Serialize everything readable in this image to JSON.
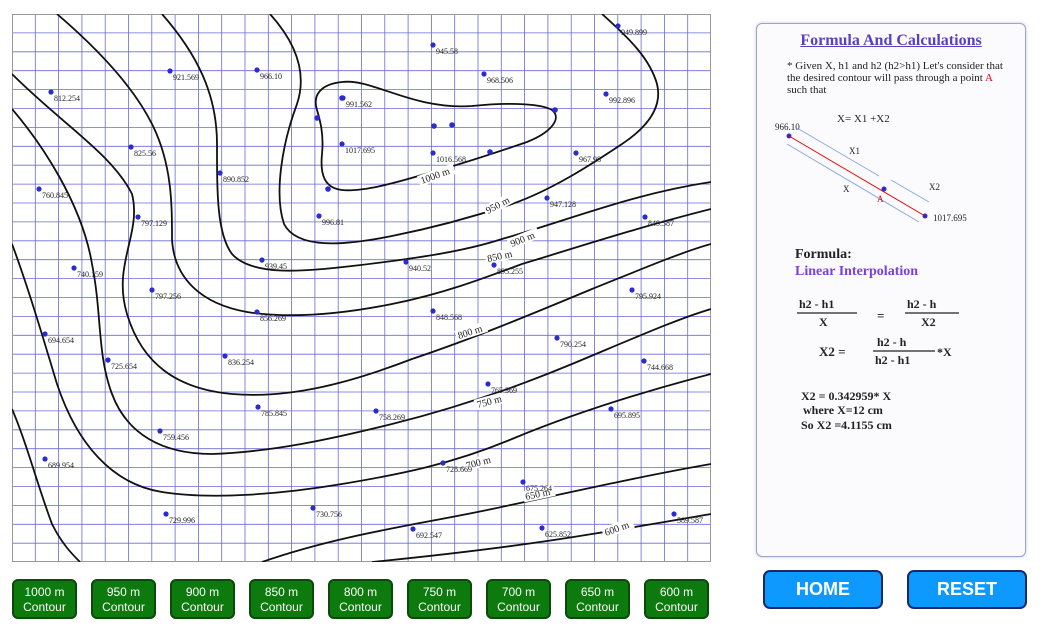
{
  "map": {
    "points": [
      {
        "label": "949.899"
      },
      {
        "label": "945.58"
      },
      {
        "label": "921.569"
      },
      {
        "label": "966.10"
      },
      {
        "label": "968.506"
      },
      {
        "label": "812.254"
      },
      {
        "label": "991.562"
      },
      {
        "label": "992.896"
      },
      {
        "label": "825.56"
      },
      {
        "label": "1017.695"
      },
      {
        "label": "1016.568"
      },
      {
        "label": "967.98"
      },
      {
        "label": "890.852"
      },
      {
        "label": "760.845"
      },
      {
        "label": "797.129"
      },
      {
        "label": "996.81"
      },
      {
        "label": "947.128"
      },
      {
        "label": "849.587"
      },
      {
        "label": "740.159"
      },
      {
        "label": "939.45"
      },
      {
        "label": "940.52"
      },
      {
        "label": "895.255"
      },
      {
        "label": "797.256"
      },
      {
        "label": "795.924"
      },
      {
        "label": "856.269"
      },
      {
        "label": "848.568"
      },
      {
        "label": "694.654"
      },
      {
        "label": "790.254"
      },
      {
        "label": "744.668"
      },
      {
        "label": "725.654"
      },
      {
        "label": "836.254"
      },
      {
        "label": "765.369"
      },
      {
        "label": "785.845"
      },
      {
        "label": "758.269"
      },
      {
        "label": "695.895"
      },
      {
        "label": "759.456"
      },
      {
        "label": "689.954"
      },
      {
        "label": "728.669"
      },
      {
        "label": "675.264"
      },
      {
        "label": "729.996"
      },
      {
        "label": "730.756"
      },
      {
        "label": "692.547"
      },
      {
        "label": "625.852"
      },
      {
        "label": "589.587"
      }
    ],
    "contour_labels": [
      "1000 m",
      "950 m",
      "900 m",
      "850 m",
      "800 m",
      "750 m",
      "700 m",
      "650 m",
      "600 m"
    ]
  },
  "buttons": [
    {
      "line1": "1000 m",
      "line2": "Contour"
    },
    {
      "line1": "950 m",
      "line2": "Contour"
    },
    {
      "line1": "900 m",
      "line2": "Contour"
    },
    {
      "line1": "850 m",
      "line2": "Contour"
    },
    {
      "line1": "800 m",
      "line2": "Contour"
    },
    {
      "line1": "750 m",
      "line2": "Contour"
    },
    {
      "line1": "700 m",
      "line2": "Contour"
    },
    {
      "line1": "650 m",
      "line2": "Contour"
    },
    {
      "line1": "600 m",
      "line2": "Contour"
    }
  ],
  "panel": {
    "title_parts": [
      "Formula",
      "And",
      "Calculations"
    ],
    "given_text": "* Given X, h1 and h2  (h2>h1) Let's consider that the desired contour will pass through a point",
    "given_point": "A",
    "given_tail": "such that",
    "equation": "X= X1 +X2",
    "diagram": {
      "top_value": "966.10",
      "bottom_value": "1017.695",
      "x1": "X1",
      "x2": "X2",
      "x": "X",
      "a": "A"
    },
    "formula_heading": "Formula:",
    "formula_name": "Linear Interpolation",
    "frac1_num": "h2 - h1",
    "frac1_den": "X",
    "frac2_num": "h2 - h",
    "frac2_den": "X2",
    "eq_sign": "=",
    "x2_lhs": "X2 =",
    "frac3_num": "h2 - h",
    "frac3_den": "h2 - h1",
    "frac3_tail": "*X",
    "result_line1": "X2 = 0.342959* X",
    "result_line2": "where X=12 cm",
    "result_line3": "So X2 =4.1155 cm"
  },
  "home_label": "HOME",
  "reset_label": "RESET",
  "colors": {
    "grid": "#6a6ad8",
    "point": "#2b2bd0",
    "button_green": "#0d7a0d",
    "button_blue": "#0d99ff",
    "title_purple": "#5a3fc0",
    "formula_purple": "#7a3fe0",
    "point_A": "#e00000"
  }
}
